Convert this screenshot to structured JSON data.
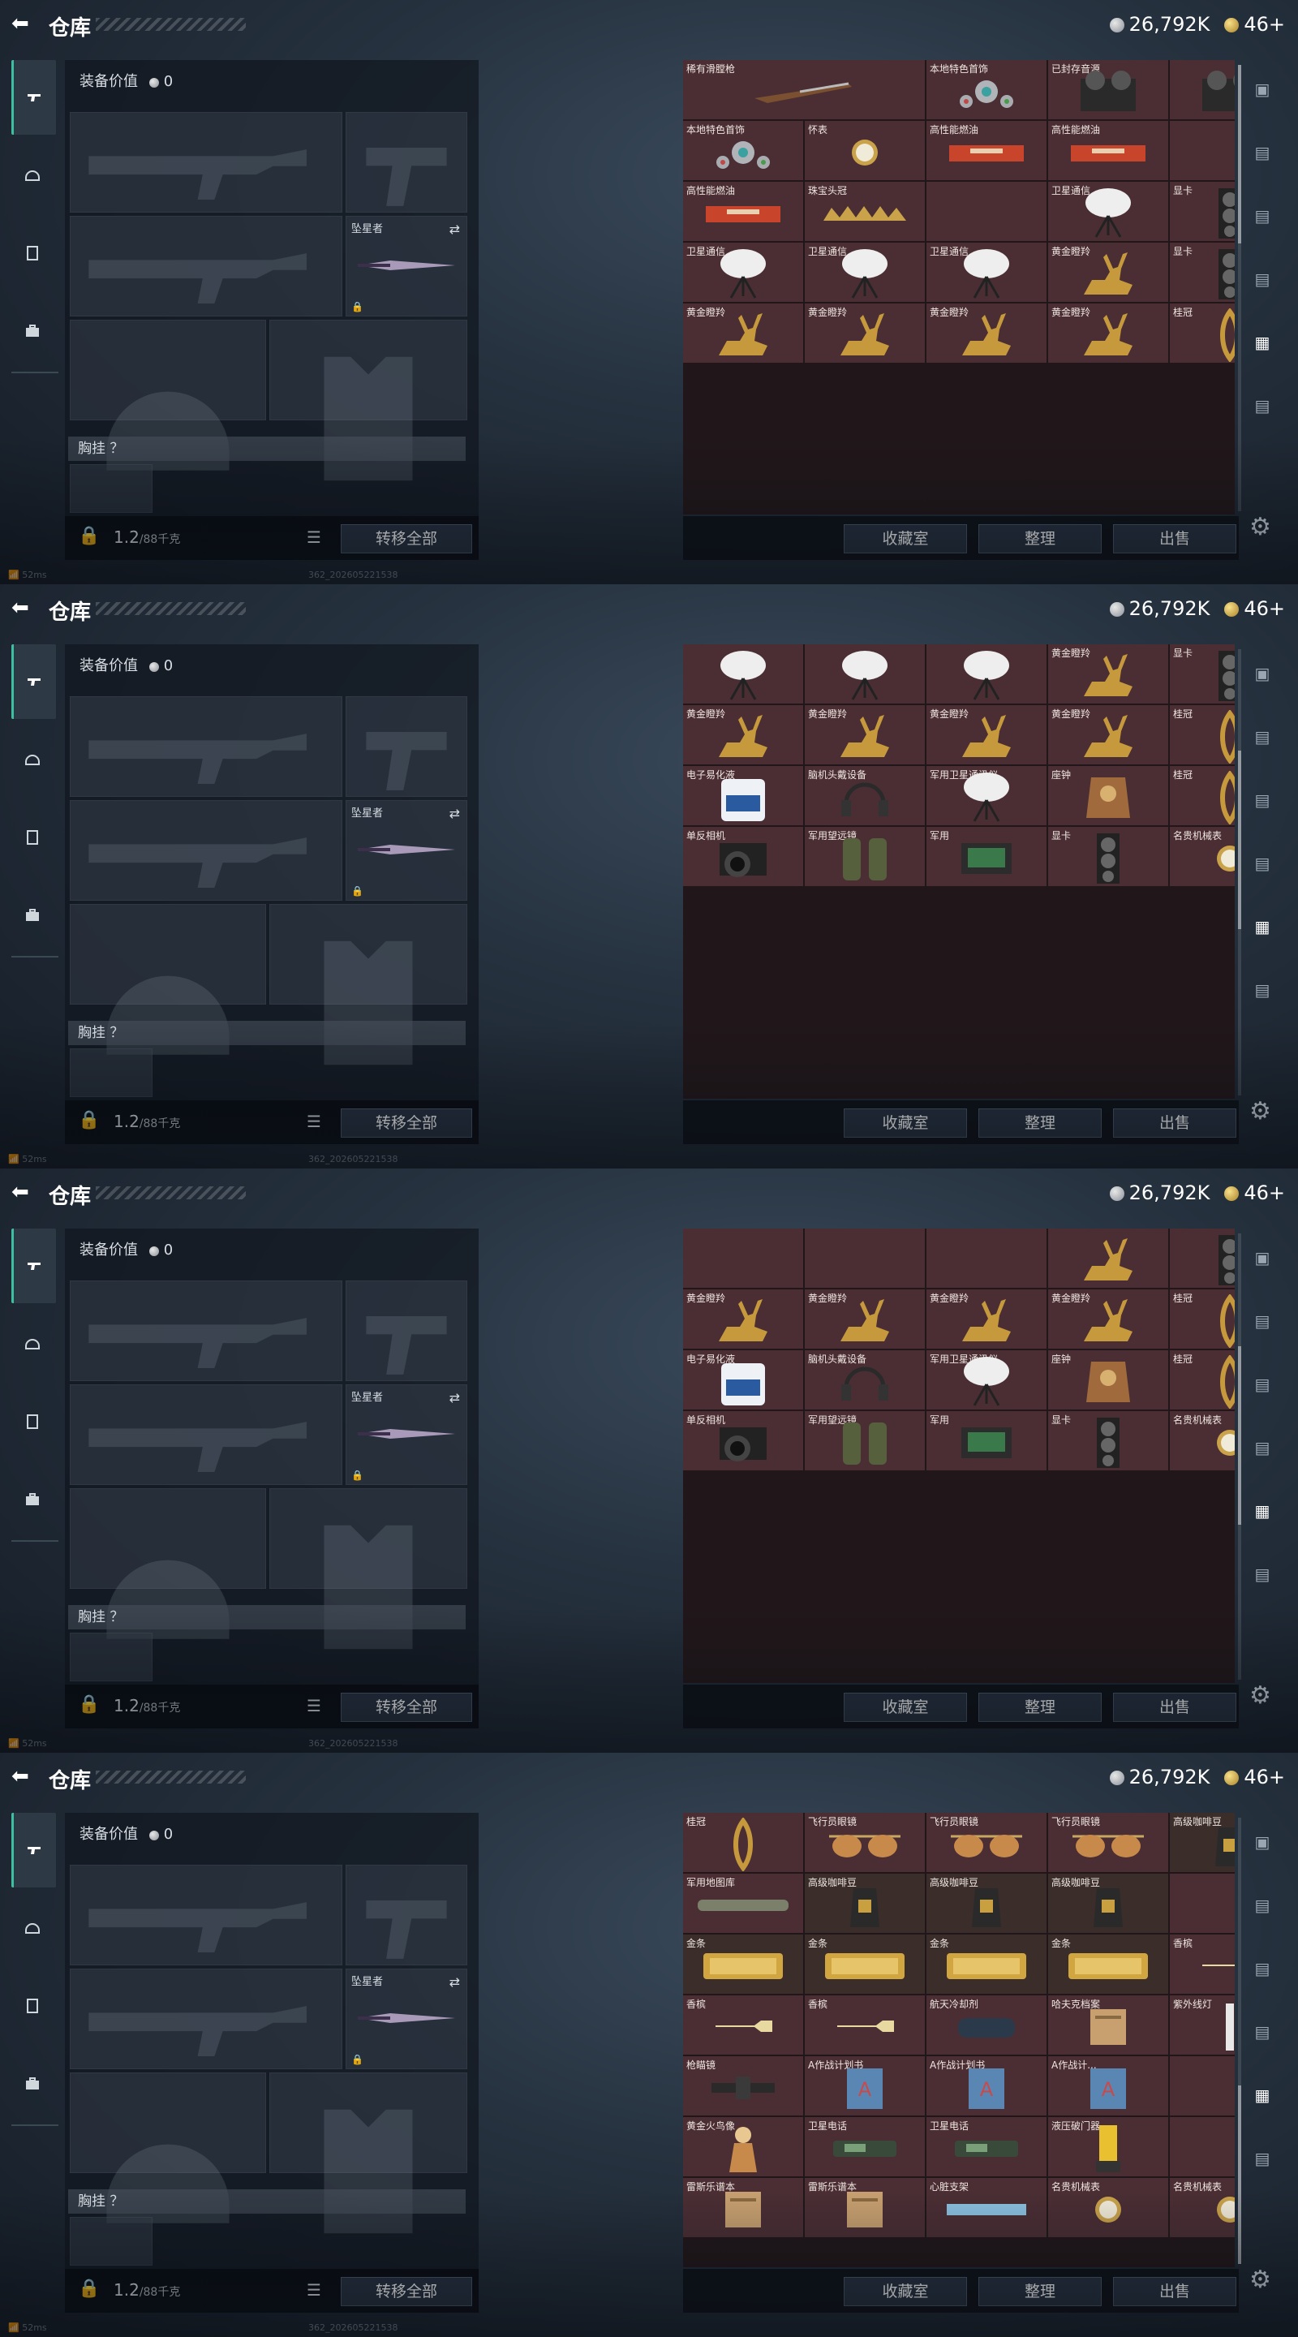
{
  "header": {
    "back_icon": "back-arrow-icon",
    "title": "仓库",
    "silver": "26,792K",
    "gold": "46+"
  },
  "left": {
    "equip_value_label": "装备价值",
    "equip_value": "0",
    "melee_label": "坠星者",
    "chest_label": "胸挂 ？",
    "weight": "1.2",
    "weight_max": "/88千克",
    "transfer_all": "转移全部"
  },
  "footer": {
    "collection": "收藏室",
    "organize": "整理",
    "sell": "出售"
  },
  "status": {
    "ping": "52ms",
    "build": "362_202605221538"
  },
  "frames": [
    {
      "scroll_pct": 0,
      "items": [
        {
          "name": "稀有滑膛枪",
          "span": 2,
          "icon": "musket"
        },
        {
          "name": "本地特色首饰",
          "span": 1,
          "icon": "jewel"
        },
        {
          "name": "已封存音源",
          "span": 1,
          "icon": "reel"
        },
        {
          "name": "",
          "span": 1,
          "icon": "reel"
        },
        {
          "name": "本地特色首饰",
          "span": 1,
          "icon": "jewel"
        },
        {
          "name": "怀表",
          "span": 1,
          "icon": "watch"
        },
        {
          "name": "高性能燃油",
          "span": 1,
          "icon": "fuel"
        },
        {
          "name": "高性能燃油",
          "span": 1,
          "icon": "fuel"
        },
        {
          "name": "",
          "span": 1,
          "icon": ""
        },
        {
          "name": "高性能燃油",
          "span": 1,
          "icon": "fuel"
        },
        {
          "name": "珠宝头冠",
          "span": 1,
          "icon": "crown"
        },
        {
          "name": "",
          "span": 1,
          "icon": ""
        },
        {
          "name": "卫星通信",
          "span": 1,
          "icon": "dish"
        },
        {
          "name": "显卡",
          "span": 1,
          "icon": "gpu"
        },
        {
          "name": "卫星通信",
          "span": 1,
          "icon": "dish"
        },
        {
          "name": "卫星通信",
          "span": 1,
          "icon": "dish"
        },
        {
          "name": "卫星通信",
          "span": 1,
          "icon": "dish"
        },
        {
          "name": "黄金瞪羚",
          "span": 1,
          "icon": "gazelle"
        },
        {
          "name": "显卡",
          "span": 1,
          "icon": "gpu"
        },
        {
          "name": "黄金瞪羚",
          "span": 1,
          "icon": "gazelle"
        },
        {
          "name": "黄金瞪羚",
          "span": 1,
          "icon": "gazelle"
        },
        {
          "name": "黄金瞪羚",
          "span": 1,
          "icon": "gazelle"
        },
        {
          "name": "黄金瞪羚",
          "span": 1,
          "icon": "gazelle"
        },
        {
          "name": "桂冠",
          "span": 1,
          "icon": "laurel"
        }
      ]
    },
    {
      "scroll_pct": 38,
      "items": [
        {
          "name": "",
          "span": 1,
          "icon": "dish"
        },
        {
          "name": "",
          "span": 1,
          "icon": "dish"
        },
        {
          "name": "",
          "span": 1,
          "icon": "dish"
        },
        {
          "name": "黄金瞪羚",
          "span": 1,
          "icon": "gazelle"
        },
        {
          "name": "显卡",
          "span": 1,
          "icon": "gpu"
        },
        {
          "name": "黄金瞪羚",
          "span": 1,
          "icon": "gazelle"
        },
        {
          "name": "黄金瞪羚",
          "span": 1,
          "icon": "gazelle"
        },
        {
          "name": "黄金瞪羚",
          "span": 1,
          "icon": "gazelle"
        },
        {
          "name": "黄金瞪羚",
          "span": 1,
          "icon": "gazelle"
        },
        {
          "name": "桂冠",
          "span": 1,
          "icon": "laurel"
        },
        {
          "name": "电子易化液",
          "span": 1,
          "icon": "jug"
        },
        {
          "name": "脑机头戴设备",
          "span": 1,
          "icon": "headset"
        },
        {
          "name": "军用卫星通讯仪",
          "span": 1,
          "icon": "dish"
        },
        {
          "name": "座钟",
          "span": 1,
          "icon": "clock"
        },
        {
          "name": "桂冠",
          "span": 1,
          "icon": "laurel"
        },
        {
          "name": "单反相机",
          "span": 1,
          "icon": "camera"
        },
        {
          "name": "军用望远镜",
          "span": 1,
          "icon": "binoc"
        },
        {
          "name": "军用",
          "span": 1,
          "icon": "board"
        },
        {
          "name": "显卡",
          "span": 1,
          "icon": "gpu"
        },
        {
          "name": "名贵机械表",
          "span": 1,
          "icon": "watch"
        }
      ]
    },
    {
      "scroll_pct": 42,
      "items": [
        {
          "name": "",
          "span": 1,
          "icon": ""
        },
        {
          "name": "",
          "span": 1,
          "icon": ""
        },
        {
          "name": "",
          "span": 1,
          "icon": ""
        },
        {
          "name": "",
          "span": 1,
          "icon": "gazelle"
        },
        {
          "name": "",
          "span": 1,
          "icon": "gpu"
        },
        {
          "name": "黄金瞪羚",
          "span": 1,
          "icon": "gazelle"
        },
        {
          "name": "黄金瞪羚",
          "span": 1,
          "icon": "gazelle"
        },
        {
          "name": "黄金瞪羚",
          "span": 1,
          "icon": "gazelle"
        },
        {
          "name": "黄金瞪羚",
          "span": 1,
          "icon": "gazelle"
        },
        {
          "name": "桂冠",
          "span": 1,
          "icon": "laurel"
        },
        {
          "name": "电子易化液",
          "span": 1,
          "icon": "jug"
        },
        {
          "name": "脑机头戴设备",
          "span": 1,
          "icon": "headset"
        },
        {
          "name": "军用卫星通讯仪",
          "span": 1,
          "icon": "dish"
        },
        {
          "name": "座钟",
          "span": 1,
          "icon": "clock"
        },
        {
          "name": "桂冠",
          "span": 1,
          "icon": "laurel"
        },
        {
          "name": "单反相机",
          "span": 1,
          "icon": "camera"
        },
        {
          "name": "军用望远镜",
          "span": 1,
          "icon": "binoc"
        },
        {
          "name": "军用",
          "span": 1,
          "icon": "board"
        },
        {
          "name": "显卡",
          "span": 1,
          "icon": "gpu"
        },
        {
          "name": "名贵机械表",
          "span": 1,
          "icon": "watch"
        }
      ]
    },
    {
      "scroll_pct": 100,
      "items": [
        {
          "name": "桂冠",
          "span": 1,
          "icon": "laurel"
        },
        {
          "name": "飞行员眼镜",
          "span": 1,
          "icon": "glasses"
        },
        {
          "name": "飞行员眼镜",
          "span": 1,
          "icon": "glasses"
        },
        {
          "name": "飞行员眼镜",
          "span": 1,
          "icon": "glasses"
        },
        {
          "name": "高级咖啡豆",
          "span": 1,
          "icon": "bag"
        },
        {
          "name": "军用地图库",
          "span": 1,
          "icon": "tube"
        },
        {
          "name": "高级咖啡豆",
          "span": 1,
          "icon": "bag"
        },
        {
          "name": "高级咖啡豆",
          "span": 1,
          "icon": "bag"
        },
        {
          "name": "高级咖啡豆",
          "span": 1,
          "icon": "bag"
        },
        {
          "name": "",
          "span": 1,
          "icon": ""
        },
        {
          "name": "金条",
          "span": 1,
          "icon": "gold"
        },
        {
          "name": "金条",
          "span": 1,
          "icon": "gold"
        },
        {
          "name": "金条",
          "span": 1,
          "icon": "gold"
        },
        {
          "name": "金条",
          "span": 1,
          "icon": "gold"
        },
        {
          "name": "香槟",
          "span": 1,
          "icon": "bottle"
        },
        {
          "name": "香槟",
          "span": 1,
          "icon": "bottle"
        },
        {
          "name": "香槟",
          "span": 1,
          "icon": "bottle"
        },
        {
          "name": "航天冷却剂",
          "span": 1,
          "icon": "tank"
        },
        {
          "name": "哈夫克档案",
          "span": 1,
          "icon": "folder"
        },
        {
          "name": "紫外线灯",
          "span": 1,
          "icon": "lamp"
        },
        {
          "name": "枪瞄镜",
          "span": 1,
          "icon": "scope"
        },
        {
          "name": "A作战计划书",
          "span": 1,
          "icon": "book"
        },
        {
          "name": "A作战计划书",
          "span": 1,
          "icon": "book"
        },
        {
          "name": "A作战计...",
          "span": 1,
          "icon": "book"
        },
        {
          "name": "",
          "span": 1,
          "icon": ""
        },
        {
          "name": "黄金火鸟像",
          "span": 1,
          "icon": "statue"
        },
        {
          "name": "卫星电话",
          "span": 1,
          "icon": "phone"
        },
        {
          "name": "卫星电话",
          "span": 1,
          "icon": "phone"
        },
        {
          "name": "液压破门器",
          "span": 1,
          "icon": "drill"
        },
        {
          "name": "",
          "span": 1,
          "icon": ""
        },
        {
          "name": "雷斯乐谱本",
          "span": 1,
          "icon": "folder"
        },
        {
          "name": "雷斯乐谱本",
          "span": 1,
          "icon": "folder"
        },
        {
          "name": "心脏支架",
          "span": 1,
          "icon": "stent"
        },
        {
          "name": "名贵机械表",
          "span": 1,
          "icon": "watch"
        },
        {
          "name": "名贵机械表",
          "span": 1,
          "icon": "watch"
        }
      ]
    }
  ]
}
